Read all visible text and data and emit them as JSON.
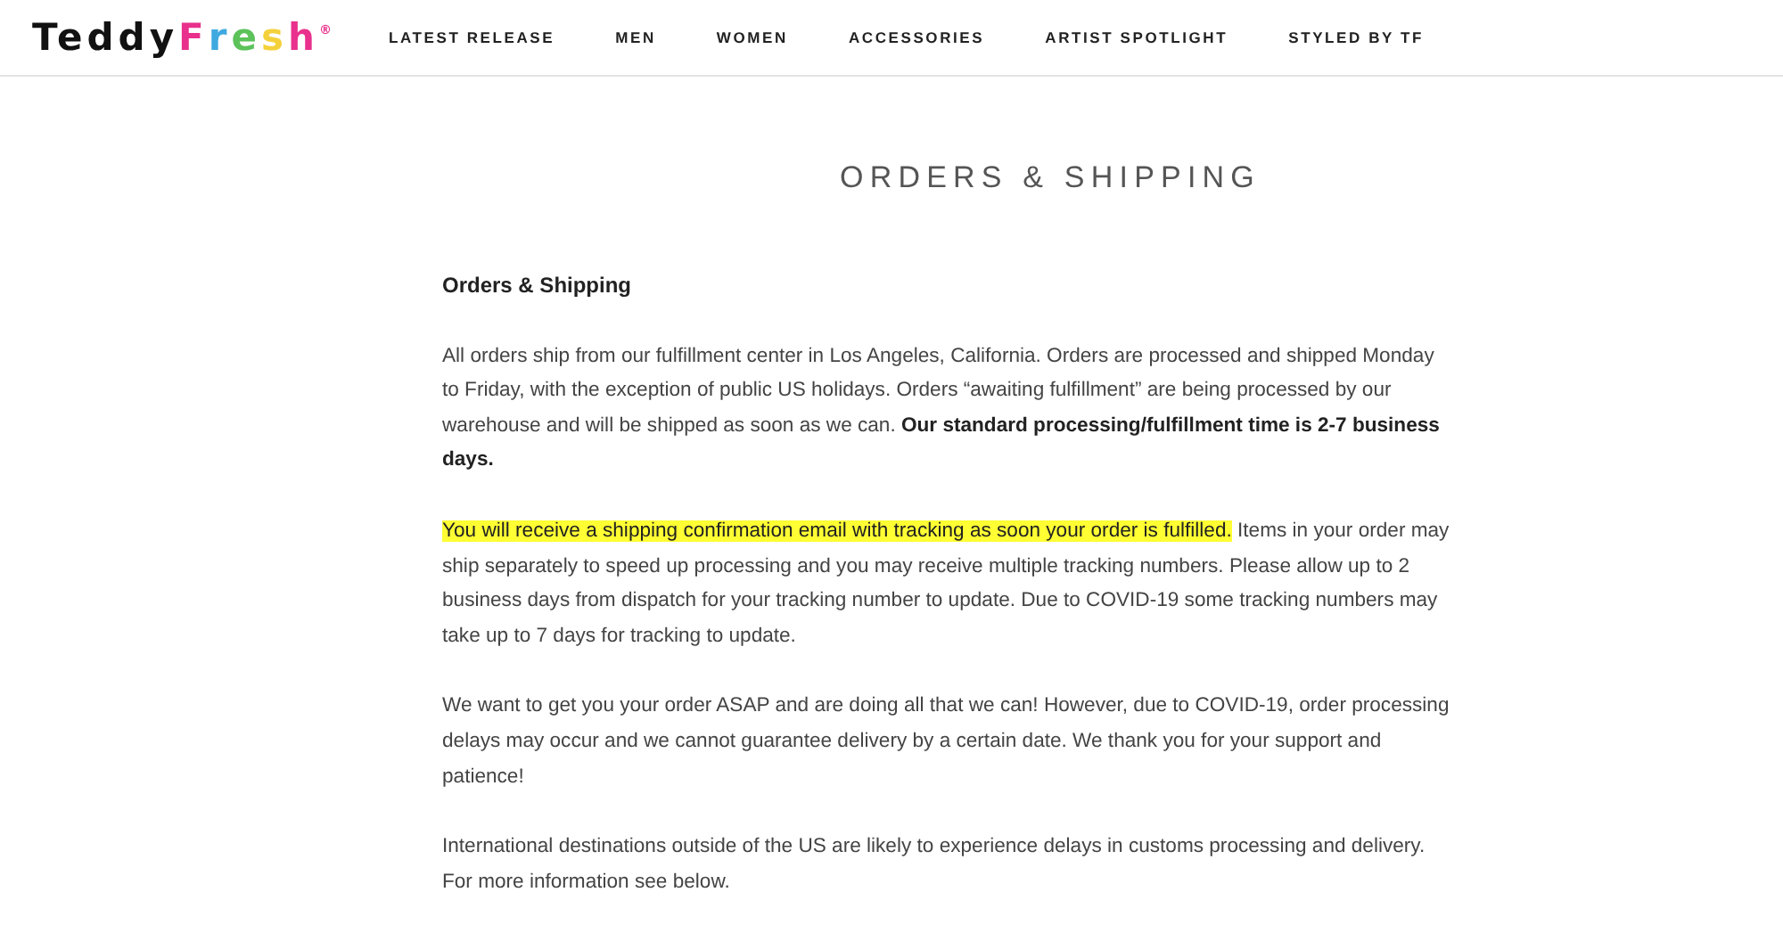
{
  "logo": {
    "parts": [
      {
        "text": "Teddy",
        "color": "#111111"
      },
      {
        "text": "F",
        "color": "#e8308c"
      },
      {
        "text": "r",
        "color": "#3fa9e0"
      },
      {
        "text": "e",
        "color": "#5cc25a"
      },
      {
        "text": "s",
        "color": "#f4d13a"
      },
      {
        "text": "h",
        "color": "#e8308c"
      }
    ],
    "mark": "®"
  },
  "nav": [
    {
      "label": "LATEST RELEASE"
    },
    {
      "label": "MEN"
    },
    {
      "label": "WOMEN"
    },
    {
      "label": "ACCESSORIES"
    },
    {
      "label": "ARTIST SPOTLIGHT"
    },
    {
      "label": "STYLED BY TF"
    }
  ],
  "page_title": "ORDERS & SHIPPING",
  "section_heading": "Orders & Shipping",
  "paragraphs": [
    [
      {
        "kind": "plain",
        "text": "All orders ship from our fulfillment center in Los Angeles, California. Orders are processed and shipped Monday to Friday, with the exception of public US holidays. Orders “awaiting fulfillment” are being processed by our warehouse and will be shipped as soon as we can. "
      },
      {
        "kind": "bold",
        "text": "Our standard processing/fulfillment time is 2-7 business days."
      }
    ],
    [
      {
        "kind": "highlight",
        "text": "You will receive a shipping confirmation email with tracking as soon your order is fulfilled."
      },
      {
        "kind": "plain",
        "text": " Items in your order may ship separately to speed up processing and you may receive multiple tracking numbers. Please allow up to 2 business days from dispatch for your tracking number to update. Due to COVID-19 some tracking numbers may take up to 7 days for tracking to update."
      }
    ],
    [
      {
        "kind": "plain",
        "text": "We want to get you your order ASAP and are doing all that we can! However, due to COVID-19, order processing delays may occur and we cannot guarantee delivery by a certain date. We thank you for your support and patience!"
      }
    ],
    [
      {
        "kind": "plain",
        "text": "International destinations outside of the US are likely to experience delays in customs processing and delivery. For more information see below."
      }
    ]
  ]
}
